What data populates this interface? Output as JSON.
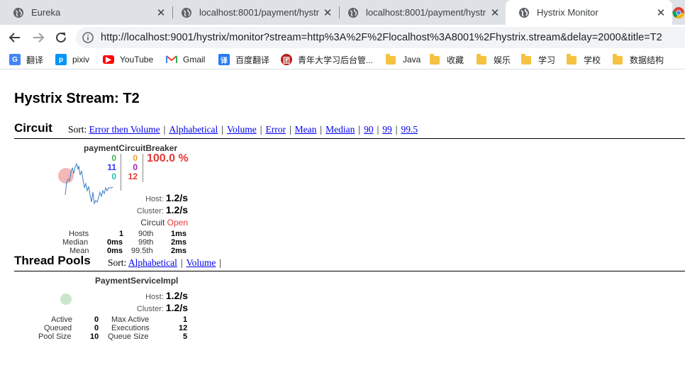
{
  "browser": {
    "tabs": [
      {
        "title": "Eureka",
        "active": false
      },
      {
        "title": "localhost:8001/payment/hystr",
        "active": false
      },
      {
        "title": "localhost:8001/payment/hystr",
        "active": false
      },
      {
        "title": "Hystrix Monitor",
        "active": true
      }
    ],
    "close_glyph": "✕",
    "url": "http://localhost:9001/hystrix/monitor?stream=http%3A%2F%2Flocalhost%3A8001%2Fhystrix.stream&delay=2000&title=T2",
    "bookmarks": [
      {
        "label": "翻译",
        "icon": "google-translate-icon"
      },
      {
        "label": "pixiv",
        "icon": "pixiv-icon"
      },
      {
        "label": "YouTube",
        "icon": "youtube-icon"
      },
      {
        "label": "Gmail",
        "icon": "gmail-icon"
      },
      {
        "label": "百度翻译",
        "icon": "baidu-translate-icon"
      },
      {
        "label": "青年大学习后台管...",
        "icon": "youth-league-icon"
      },
      {
        "label": "Java",
        "icon": "folder-icon"
      },
      {
        "label": "收藏",
        "icon": "folder-icon"
      },
      {
        "label": "娱乐",
        "icon": "folder-icon"
      },
      {
        "label": "学习",
        "icon": "folder-icon"
      },
      {
        "label": "学校",
        "icon": "folder-icon"
      },
      {
        "label": "数据结构",
        "icon": "folder-icon"
      }
    ]
  },
  "page": {
    "title": "Hystrix Stream: T2",
    "circuit": {
      "heading": "Circuit",
      "sort_label": "Sort:",
      "sort_links": [
        "Error then Volume",
        "Alphabetical",
        "Volume",
        "Error",
        "Mean",
        "Median",
        "90",
        "99",
        "99.5"
      ],
      "card": {
        "name": "paymentCircuitBreaker",
        "counts": {
          "success": "0",
          "short_circuited": "11",
          "bad_request": "0",
          "timeout": "0",
          "rejected": "0",
          "failure": "12"
        },
        "error_rate": "100.0 %",
        "host_label": "Host:",
        "host_rate": "1.2/s",
        "cluster_label": "Cluster:",
        "cluster_rate": "1.2/s",
        "circuit_label": "Circuit",
        "circuit_status": "Open",
        "stats": {
          "hosts_label": "Hosts",
          "hosts": "1",
          "median_label": "Median",
          "median": "0ms",
          "mean_label": "Mean",
          "mean": "0ms",
          "p90_label": "90th",
          "p90": "1ms",
          "p99_label": "99th",
          "p99": "2ms",
          "p995_label": "99.5th",
          "p995": "2ms"
        }
      }
    },
    "thread_pools": {
      "heading": "Thread Pools",
      "sort_label": "Sort:",
      "sort_links": [
        "Alphabetical",
        "Volume"
      ],
      "card": {
        "name": "PaymentServiceImpl",
        "host_label": "Host:",
        "host_rate": "1.2/s",
        "cluster_label": "Cluster:",
        "cluster_rate": "1.2/s",
        "stats": {
          "active_label": "Active",
          "active": "0",
          "queued_label": "Queued",
          "queued": "0",
          "pool_size_label": "Pool Size",
          "pool_size": "10",
          "max_active_label": "Max Active",
          "max_active": "1",
          "executions_label": "Executions",
          "executions": "12",
          "queue_size_label": "Queue Size",
          "queue_size": "5"
        }
      }
    }
  },
  "colors": {
    "success": "#4caf50",
    "short_circuited": "#3333ff",
    "bad_request": "#2abfac",
    "timeout": "#e6a23c",
    "rejected": "#9c27b0",
    "failure": "#e53935",
    "link": "#0000ee"
  }
}
